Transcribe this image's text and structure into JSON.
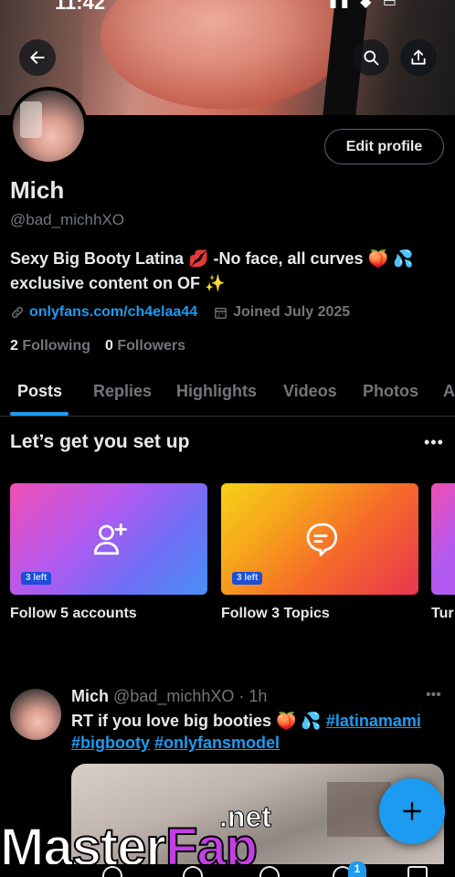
{
  "status_bar": {
    "time": "11:42",
    "icons": "▮▮ ◆ ▭"
  },
  "header": {
    "back_icon": "arrow-left-icon",
    "search_icon": "search-icon",
    "share_icon": "share-icon"
  },
  "profile": {
    "edit_label": "Edit profile",
    "name": "Mich",
    "handle": "@bad_michhXO",
    "bio_line1": "Sexy Big Booty Latina 💋 -No face, all curves 🍑 💦",
    "bio_line2": "exclusive content on OF ✨",
    "link": "onlyfans.com/ch4elaa44",
    "joined": "Joined July 2025",
    "following_count": "2",
    "following_label": "Following",
    "followers_count": "0",
    "followers_label": "Followers"
  },
  "tabs": [
    "Posts",
    "Replies",
    "Highlights",
    "Videos",
    "Photos",
    "A"
  ],
  "setup": {
    "title": "Let’s get you set up",
    "more": "•••",
    "cards": [
      {
        "badge": "3 left",
        "label": "Follow 5 accounts",
        "icon": "add-user-icon"
      },
      {
        "badge": "3 left",
        "label": "Follow 3 Topics",
        "icon": "topic-icon"
      },
      {
        "label": "Tur"
      }
    ]
  },
  "post": {
    "name": "Mich",
    "meta": "@bad_michhXO · 1h",
    "more": "•••",
    "text": "RT if you love big booties 🍑 💦 ",
    "hashtags": [
      "#latinamami",
      "#bigbooty",
      "#onlyfansmodel"
    ]
  },
  "fab": {
    "icon": "plus-icon"
  },
  "watermark": {
    "main_a": "Master",
    "main_b": "Fap",
    "net": ".net"
  },
  "bottom_nav": {
    "badge": "1"
  },
  "colors": {
    "accent": "#1d9bf0",
    "muted": "#71767b",
    "text": "#e7e9ea",
    "border": "#2f3336"
  }
}
